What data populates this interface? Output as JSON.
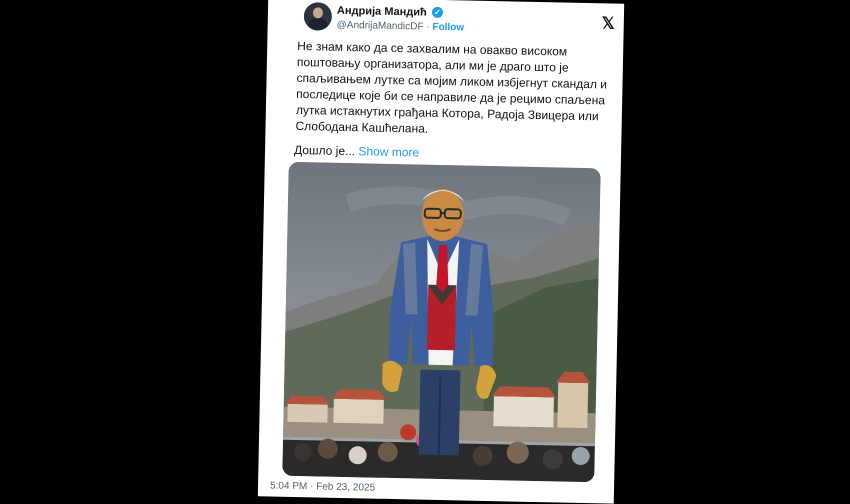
{
  "tweet": {
    "author_name": "Андрија Мандић",
    "handle": "@AndrijaMandicDF",
    "separator": "·",
    "follow_label": "Follow",
    "verified_icon": "verified-badge-icon",
    "x_logo": "𝕏",
    "body_text": "Не знам како да се захвалим на овакво високом\nпоштовању организатора, али ми је драго што је\nспаљивањем лутке са мојим ликом избјегнут скандал и\nпоследице које би се направиле да је рецимо спаљена\nлутка истакнутих грађана Котора, Радоја Звицера или\nСлободана Кашћелана.",
    "truncated_text": "Дошло је...",
    "show_more_label": "Show more",
    "timestamp": "5:04 PM · Feb 23, 2025"
  },
  "media": {
    "description_icon": "photo-carnival-effigy"
  },
  "colors": {
    "accent": "#1d9bf0",
    "text": "#0f1419",
    "muted": "#536471",
    "background": "#000000"
  }
}
